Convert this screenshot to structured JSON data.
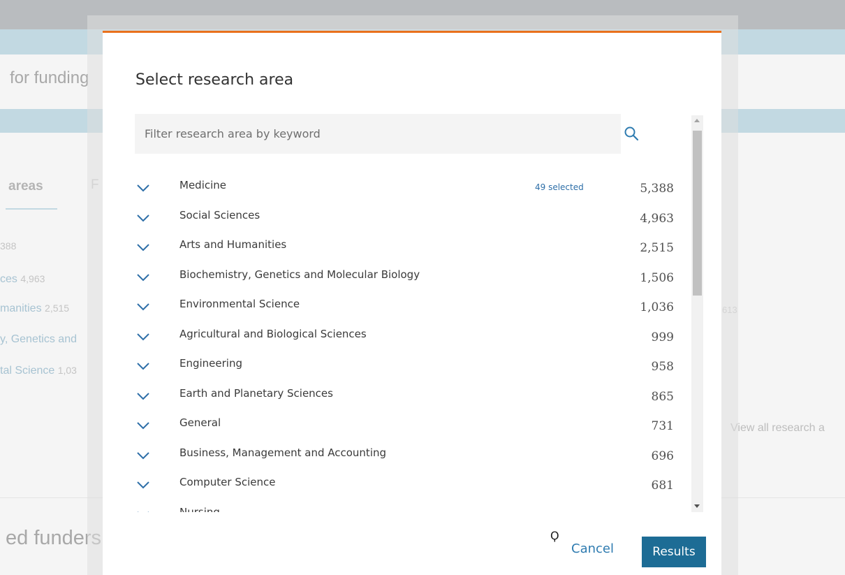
{
  "background": {
    "search_fragment": "for funding",
    "tab_active": "areas",
    "tab_next": "F",
    "list": [
      {
        "label": "",
        "count": "388"
      },
      {
        "label": "ces",
        "count": "4,963"
      },
      {
        "label": "manities",
        "count": "2,515"
      },
      {
        "label": "y, Genetics and",
        "count": ""
      },
      {
        "label": "tal Science",
        "count": "1,03"
      }
    ],
    "right_count": "613",
    "view_all": "View all research a",
    "funders_heading": "ed funders"
  },
  "modal": {
    "title": "Select research area",
    "filter_placeholder": "Filter research area by keyword",
    "items": [
      {
        "name": "Medicine",
        "selected": "49 selected",
        "count": "5,388"
      },
      {
        "name": "Social Sciences",
        "selected": "",
        "count": "4,963"
      },
      {
        "name": "Arts and Humanities",
        "selected": "",
        "count": "2,515"
      },
      {
        "name": "Biochemistry, Genetics and Molecular Biology",
        "selected": "",
        "count": "1,506"
      },
      {
        "name": "Environmental Science",
        "selected": "",
        "count": "1,036"
      },
      {
        "name": "Agricultural and Biological Sciences",
        "selected": "",
        "count": "999"
      },
      {
        "name": "Engineering",
        "selected": "",
        "count": "958"
      },
      {
        "name": "Earth and Planetary Sciences",
        "selected": "",
        "count": "865"
      },
      {
        "name": "General",
        "selected": "",
        "count": "731"
      },
      {
        "name": "Business, Management and Accounting",
        "selected": "",
        "count": "696"
      },
      {
        "name": "Computer Science",
        "selected": "",
        "count": "681"
      },
      {
        "name": "Nursing",
        "selected": "",
        "count": ""
      }
    ],
    "cancel_label": "Cancel",
    "results_label": "Results"
  },
  "colors": {
    "accent_top_border": "#e9711c",
    "primary_button": "#1d6c95",
    "link": "#2e7bb0",
    "chevron": "#2e6fa8"
  },
  "icons": {
    "search": "search-icon",
    "expand": "chevron-down-icon",
    "cursor": "busy-cursor-icon"
  }
}
